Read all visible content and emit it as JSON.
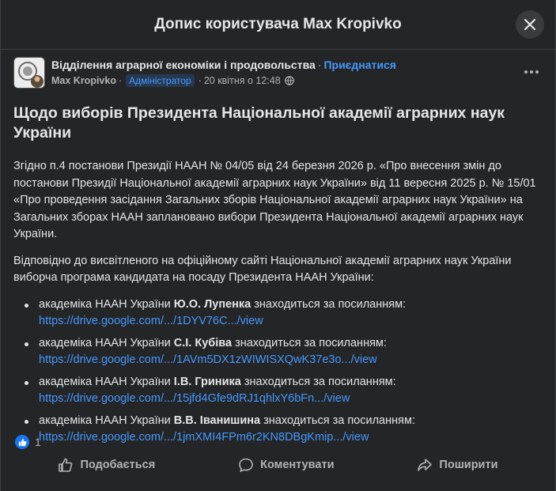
{
  "dialog": {
    "title": "Допис користувача Max Kropivko",
    "close_icon": "close-icon"
  },
  "post": {
    "group_name": "Відділення аграрної економіки і продовольства",
    "join_label": "Приєднатися",
    "author": "Max Kropivko",
    "role_badge": "Адміністратор",
    "timestamp": "20 квітня о 12:48",
    "title": "Щодо виборів Президента Національної академії аграрних наук України",
    "paragraph1": "Згідно п.4 постанови Президії НААН № 04/05 від 24 березня 2026 р. «Про внесення змін до постанови Президії Національної академії аграрних наук України» від 11 вересня 2025 р. № 15/01 «Про проведення засідання Загальних зборів Національної академії аграрних наук України» на Загальних зборах НААН заплановано вибори Президента Національної академії аграрних наук України.",
    "paragraph2": "Відповідно до висвітленого на офіційному сайті Національної академії аграрних наук України виборча програма кандидата на посаду Президента НААН України:",
    "candidates": [
      {
        "prefix": "академіка НААН України ",
        "name": "Ю.О. Лупенка",
        "suffix": " знаходиться за посиланням:",
        "link": "https://drive.google.com/.../1DYV76C.../view"
      },
      {
        "prefix": "академіка НААН України ",
        "name": "С.І. Кубіва",
        "suffix": " знаходиться за посиланням:",
        "link": "https://drive.google.com/.../1AVm5DX1zWIWISXQwK37e3o.../view"
      },
      {
        "prefix": "академіка НААН України ",
        "name": "І.В. Гриника",
        "suffix": " знаходиться за посиланням:",
        "link": "https://drive.google.com/.../15jfd4Gfe9dRJ1qhlxY6bFn.../view"
      },
      {
        "prefix": "академіка НААН України ",
        "name": "В.В. Іванишина",
        "suffix": " знаходиться за посиланням:",
        "link": "https://drive.google.com/.../1jmXMI4FPm6r2KN8DBgKmip.../view"
      }
    ],
    "reaction_count": "1"
  },
  "actions": {
    "like": "Подобається",
    "comment": "Коментувати",
    "share": "Поширити"
  },
  "colors": {
    "background": "#242526",
    "accent": "#4599ff",
    "like_blue": "#1877f2"
  }
}
